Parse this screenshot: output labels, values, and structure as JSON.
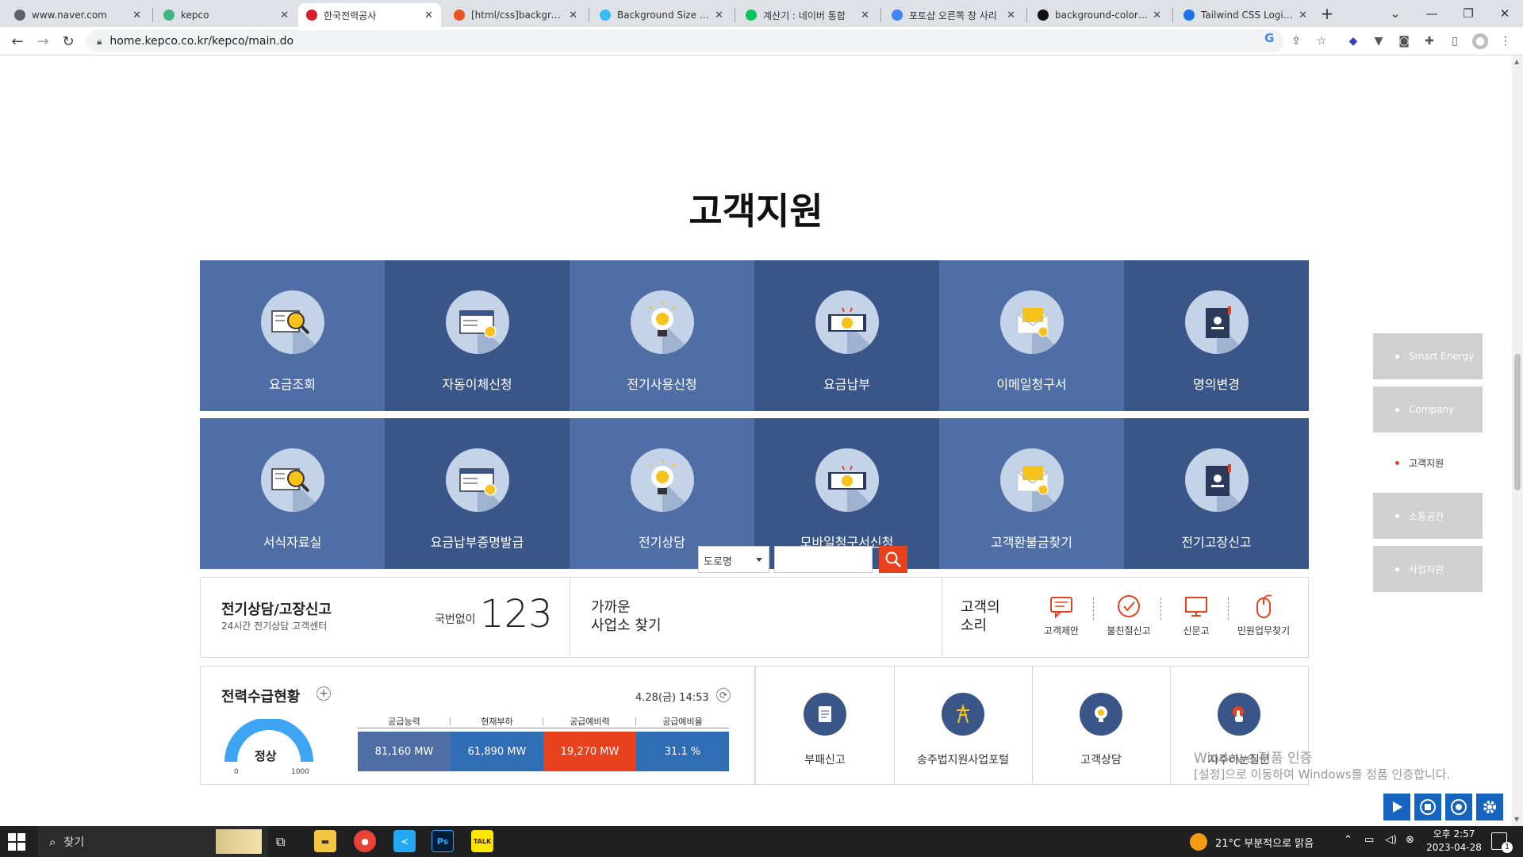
{
  "browser": {
    "tabs": [
      {
        "title": "www.naver.com",
        "fav_color": "#5f6368"
      },
      {
        "title": "kepco",
        "fav_color": "#41b883"
      },
      {
        "title": "한국전력공사",
        "fav_color": "#d81e2a"
      },
      {
        "title": "[html/css]background",
        "fav_color": "#e8541f"
      },
      {
        "title": "Background Size - Ta",
        "fav_color": "#38bdf8"
      },
      {
        "title": "계산기 : 네이버 통합",
        "fav_color": "#03c75a"
      },
      {
        "title": "포토샵 오른쪽 창 사리",
        "fav_color": "#4285f4"
      },
      {
        "title": "background-color - C",
        "fav_color": "#111111"
      },
      {
        "title": "Tailwind CSS Login Fo",
        "fav_color": "#1a73e8"
      }
    ],
    "active_tab": 2,
    "url": "home.kepco.co.kr/kepco/main.do",
    "new_tab_label": "+",
    "icons": {
      "back": "arrow-left-icon",
      "forward": "arrow-right-icon",
      "reload": "reload-icon",
      "lock": "lock-icon",
      "google": "google-icon",
      "share": "share-icon",
      "bookmark": "star-icon",
      "minimize": "minimize-icon",
      "maximize": "restore-icon",
      "close": "close-icon"
    }
  },
  "section": {
    "title": "고객지원"
  },
  "services": [
    {
      "label": "요금조회",
      "icon": "bill-search-icon"
    },
    {
      "label": "자동이체신청",
      "icon": "auto-transfer-icon"
    },
    {
      "label": "전기사용신청",
      "icon": "bulb-icon"
    },
    {
      "label": "요금납부",
      "icon": "payment-icon"
    },
    {
      "label": "이메일청구서",
      "icon": "email-bill-icon"
    },
    {
      "label": "명의변경",
      "icon": "id-card-icon"
    },
    {
      "label": "서식자료실",
      "icon": "form-search-icon"
    },
    {
      "label": "요금납부증명발급",
      "icon": "certificate-icon"
    },
    {
      "label": "전기상담",
      "icon": "consult-bulb-icon"
    },
    {
      "label": "모바일청구서신청",
      "icon": "mobile-bill-icon"
    },
    {
      "label": "고객환불금찾기",
      "icon": "refund-icon"
    },
    {
      "label": "전기고장신고",
      "icon": "outage-report-icon"
    }
  ],
  "consult": {
    "title": "전기상담/고장신고",
    "subtitle": "24시간 전기상담 고객센터",
    "prefix": "국번없이",
    "number": "123"
  },
  "office": {
    "title_line1": "가까운",
    "title_line2": "사업소 찾기",
    "select_value": "도로명",
    "input_value": ""
  },
  "voice": {
    "title_line1": "고객의",
    "title_line2": "소리",
    "items": [
      {
        "label": "고객제안",
        "icon": "suggestion-chat-icon"
      },
      {
        "label": "불친절신고",
        "icon": "check-circle-icon"
      },
      {
        "label": "신문고",
        "icon": "monitor-icon"
      },
      {
        "label": "민원업무찾기",
        "icon": "mouse-icon"
      }
    ]
  },
  "supply": {
    "title": "전력수급현황",
    "datetime": "4.28(금) 14:53",
    "gauge_status": "정상",
    "gauge_min": "0",
    "gauge_max": "1000",
    "headers": [
      "공급능력",
      "현재부하",
      "공급예비력",
      "공급예비율"
    ],
    "values": [
      "81,160 MW",
      "61,890 MW",
      "19,270 MW",
      "31.1 %"
    ],
    "colors": [
      "#4f6ea6",
      "#2f6db5",
      "#e8411d",
      "#2f6db5"
    ]
  },
  "quick_links": [
    {
      "label": "부패신고",
      "icon": "document-icon"
    },
    {
      "label": "송주법지원사업포털",
      "icon": "power-tower-icon"
    },
    {
      "label": "고객상담",
      "icon": "lightbulb-icon"
    },
    {
      "label": "자주하는질문",
      "icon": "hand-pointer-icon"
    }
  ],
  "side_nav": [
    {
      "label": "Smart Energy",
      "active": false
    },
    {
      "label": "Company",
      "active": false
    },
    {
      "label": "고객지원",
      "active": true
    },
    {
      "label": "소통공간",
      "active": false
    },
    {
      "label": "사업지원",
      "active": false
    }
  ],
  "watermark": {
    "line1": "Windows 정품 인증",
    "line2": "[설정]으로 이동하여 Windows를 정품 인증합니다."
  },
  "taskbar": {
    "search_placeholder": "찾기",
    "weather": "21°C  부분적으로 맑음",
    "time": "오후 2:57",
    "date": "2023-04-28",
    "notification_count": "1",
    "apps": [
      {
        "name": "file-explorer-icon",
        "color": "#f4c542"
      },
      {
        "name": "chrome-icon",
        "color": "#e94335"
      },
      {
        "name": "vscode-icon",
        "color": "#23a8f2"
      },
      {
        "name": "photoshop-icon",
        "color": "#001e36"
      },
      {
        "name": "kakaotalk-icon",
        "color": "#fee500"
      }
    ]
  }
}
